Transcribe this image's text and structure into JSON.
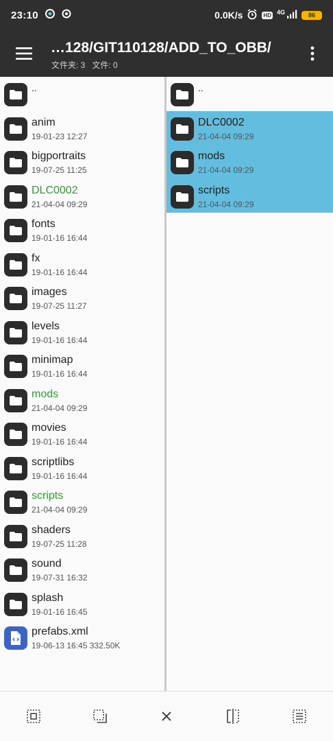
{
  "status": {
    "time": "23:10",
    "network_speed": "0.0K/s",
    "hd_label": "HD",
    "signal_label": "4G",
    "battery": "86"
  },
  "header": {
    "title": "…128/GIT110128/ADD_TO_OBB/",
    "folders_count": "文件夹: 3",
    "files_count": "文件: 0"
  },
  "left_pane": {
    "up_label": "..",
    "items": [
      {
        "name": "anim",
        "meta": "19-01-23 12:27",
        "highlight": false
      },
      {
        "name": "bigportraits",
        "meta": "19-07-25 11:25",
        "highlight": false
      },
      {
        "name": "DLC0002",
        "meta": "21-04-04 09:29",
        "highlight": true
      },
      {
        "name": "fonts",
        "meta": "19-01-16 16:44",
        "highlight": false
      },
      {
        "name": "fx",
        "meta": "19-01-16 16:44",
        "highlight": false
      },
      {
        "name": "images",
        "meta": "19-07-25 11:27",
        "highlight": false
      },
      {
        "name": "levels",
        "meta": "19-01-16 16:44",
        "highlight": false
      },
      {
        "name": "minimap",
        "meta": "19-01-16 16:44",
        "highlight": false
      },
      {
        "name": "mods",
        "meta": "21-04-04 09:29",
        "highlight": true
      },
      {
        "name": "movies",
        "meta": "19-01-16 16:44",
        "highlight": false
      },
      {
        "name": "scriptlibs",
        "meta": "19-01-16 16:44",
        "highlight": false
      },
      {
        "name": "scripts",
        "meta": "21-04-04 09:29",
        "highlight": true
      },
      {
        "name": "shaders",
        "meta": "19-07-25 11:28",
        "highlight": false
      },
      {
        "name": "sound",
        "meta": "19-07-31 16:32",
        "highlight": false
      },
      {
        "name": "splash",
        "meta": "19-01-16 16:45",
        "highlight": false
      },
      {
        "name": "prefabs.xml",
        "meta": "19-06-13 16:45  332.50K",
        "highlight": false,
        "file": true
      }
    ]
  },
  "right_pane": {
    "up_label": "..",
    "items": [
      {
        "name": "DLC0002",
        "meta": "21-04-04 09:29",
        "selected": true
      },
      {
        "name": "mods",
        "meta": "21-04-04 09:29",
        "selected": true
      },
      {
        "name": "scripts",
        "meta": "21-04-04 09:29",
        "selected": true
      }
    ]
  },
  "bottom_bar": {
    "icons": [
      "select-all-icon",
      "select-range-icon",
      "close-icon",
      "split-compare-icon",
      "select-list-icon"
    ]
  },
  "colors": {
    "bar_bg": "#2f2f2f",
    "selected_bg": "#62bddf",
    "highlight_text": "#28a428",
    "file_icon_bg": "#3c64c6"
  }
}
